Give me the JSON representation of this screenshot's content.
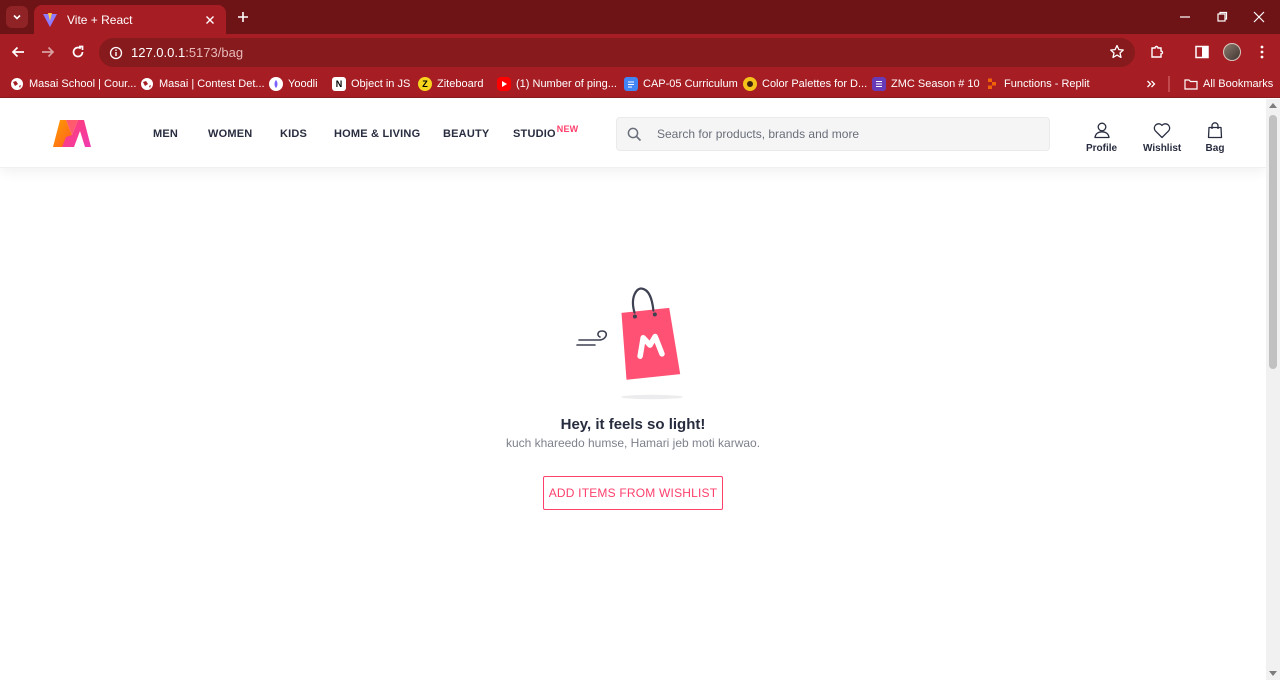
{
  "browser": {
    "tab_title": "Vite + React",
    "url_host": "127.0.0.1",
    "url_rest": ":5173/bag",
    "bookmarks": [
      {
        "label": "Masai School | Cour...",
        "icon": "globe-icon"
      },
      {
        "label": "Masai | Contest Det...",
        "icon": "globe-icon"
      },
      {
        "label": "Yoodli",
        "icon": "yoodli-icon"
      },
      {
        "label": "Object in JS",
        "icon": "notion-icon"
      },
      {
        "label": "Ziteboard",
        "icon": "ziteboard-icon"
      },
      {
        "label": "(1) Number of ping...",
        "icon": "youtube-icon"
      },
      {
        "label": "CAP-05 Curriculum",
        "icon": "docs-icon"
      },
      {
        "label": "Color Palettes for D...",
        "icon": "palette-icon"
      },
      {
        "label": "ZMC Season # 10",
        "icon": "forms-icon"
      },
      {
        "label": "Functions - Replit",
        "icon": "replit-icon"
      }
    ],
    "all_bookmarks": "All Bookmarks"
  },
  "header": {
    "nav": [
      "MEN",
      "WOMEN",
      "KIDS",
      "HOME & LIVING",
      "BEAUTY",
      "STUDIO"
    ],
    "studio_badge": "NEW",
    "search_placeholder": "Search for products, brands and more",
    "actions": {
      "profile": "Profile",
      "wishlist": "Wishlist",
      "bag": "Bag"
    }
  },
  "empty_bag": {
    "title": "Hey, it feels so light!",
    "subtitle": "kuch khareedo humse, Hamari jeb moti karwao.",
    "button": "ADD ITEMS FROM WISHLIST"
  },
  "colors": {
    "accent": "#ff3f6c",
    "browser": "#a61d23",
    "text": "#282c3f"
  }
}
